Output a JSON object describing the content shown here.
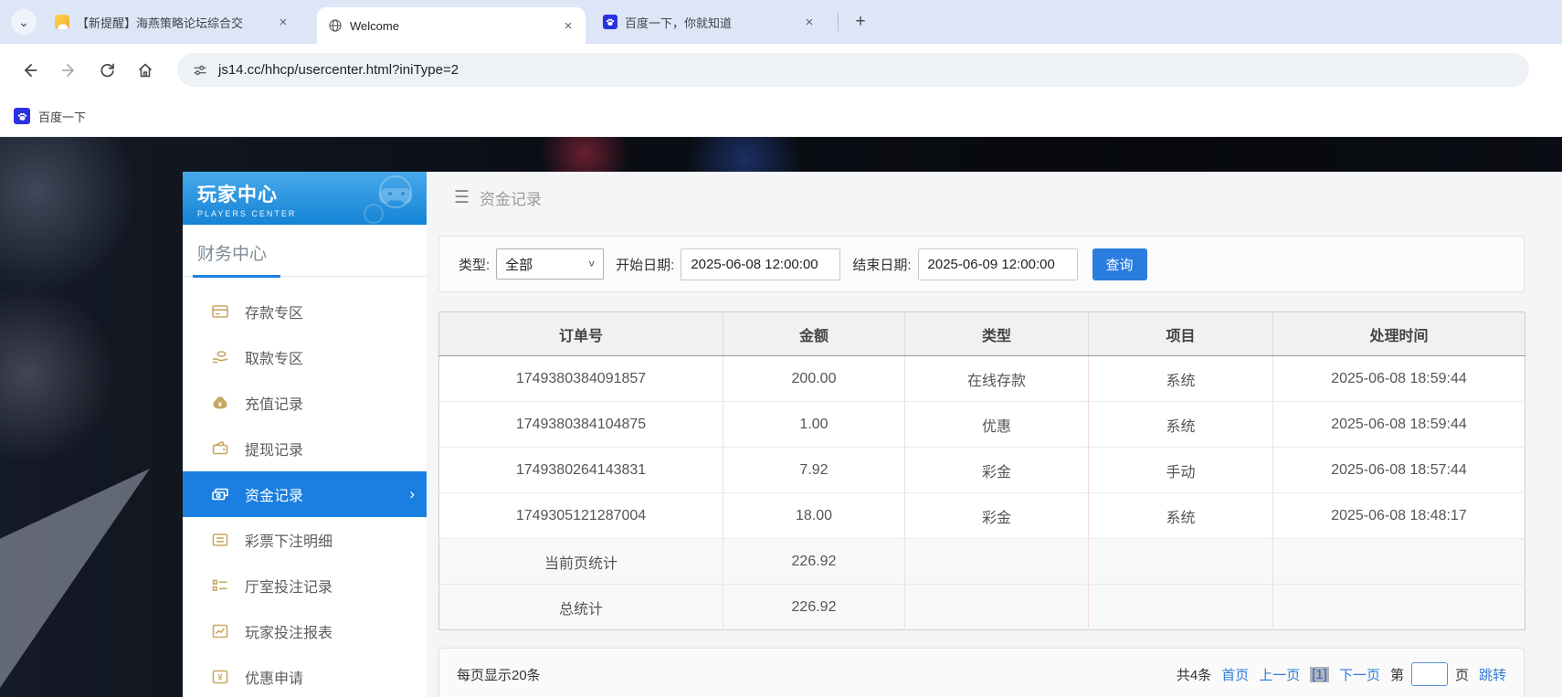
{
  "browser": {
    "tabs": [
      {
        "title": "【新提醒】海燕策略论坛综合交"
      },
      {
        "title": "Welcome"
      },
      {
        "title": "百度一下，你就知道"
      }
    ],
    "url": "js14.cc/hhcp/usercenter.html?iniType=2",
    "bookmark_label": "百度一下"
  },
  "icons": {
    "close": "×",
    "new_tab": "+",
    "tab_search_chevron": "⌄",
    "hamburger": "☰",
    "select_caret": "˅",
    "active_chevron": "›"
  },
  "sidebar": {
    "title": "玩家中心",
    "subtitle": "PLAYERS CENTER",
    "section": "财务中心",
    "items": [
      {
        "label": "存款专区",
        "active": false
      },
      {
        "label": "取款专区",
        "active": false
      },
      {
        "label": "充值记录",
        "active": false
      },
      {
        "label": "提现记录",
        "active": false
      },
      {
        "label": "资金记录",
        "active": true
      },
      {
        "label": "彩票下注明细",
        "active": false
      },
      {
        "label": "厅室投注记录",
        "active": false
      },
      {
        "label": "玩家投注报表",
        "active": false
      },
      {
        "label": "优惠申请",
        "active": false
      }
    ]
  },
  "main": {
    "page_title": "资金记录",
    "filters": {
      "type_label": "类型:",
      "type_value": "全部",
      "start_label": "开始日期:",
      "start_value": "2025-06-08 12:00:00",
      "end_label": "结束日期:",
      "end_value": "2025-06-09 12:00:00",
      "search_button": "查询"
    },
    "table": {
      "headers": [
        "订单号",
        "金额",
        "类型",
        "项目",
        "处理时间"
      ],
      "rows": [
        [
          "1749380384091857",
          "200.00",
          "在线存款",
          "系统",
          "2025-06-08 18:59:44"
        ],
        [
          "1749380384104875",
          "1.00",
          "优惠",
          "系统",
          "2025-06-08 18:59:44"
        ],
        [
          "1749380264143831",
          "7.92",
          "彩金",
          "手动",
          "2025-06-08 18:57:44"
        ],
        [
          "1749305121287004",
          "18.00",
          "彩金",
          "系统",
          "2025-06-08 18:48:17"
        ]
      ],
      "summary": [
        [
          "当前页统计",
          "226.92"
        ],
        [
          "总统计",
          "226.92"
        ]
      ]
    },
    "pagination": {
      "per_page": "每页显示20条",
      "total": "共4条",
      "first": "首页",
      "prev": "上一页",
      "current": "[1]",
      "next": "下一页",
      "jump_pre": "第",
      "jump_post": "页",
      "jump": "跳转"
    }
  },
  "colors": {
    "accent_blue": "#1a7fe0",
    "button_blue": "#2a7cdf",
    "link_blue": "#2f7cd8",
    "gold_icon": "#c8a763",
    "baidu_blue": "#2932e1",
    "sidebar_header_top": "#47a9ea",
    "sidebar_header_bottom": "#1484d6"
  }
}
